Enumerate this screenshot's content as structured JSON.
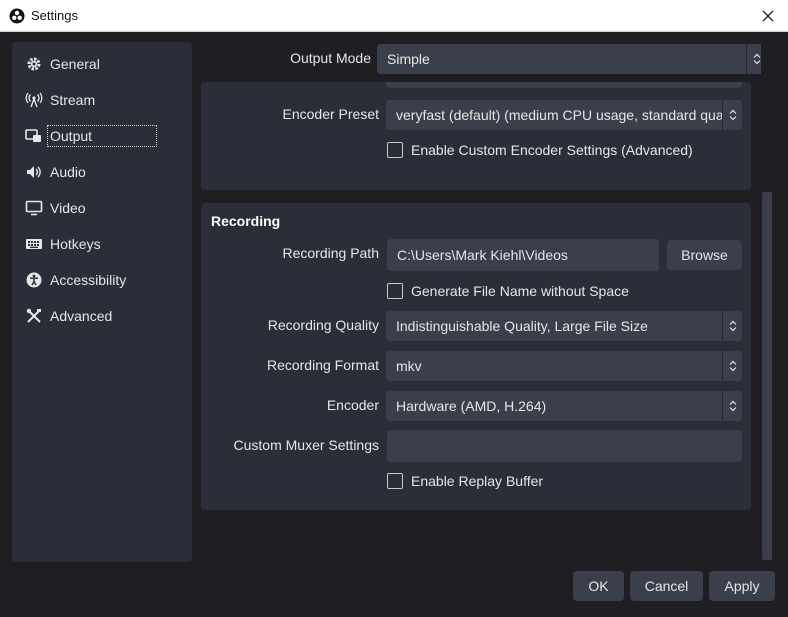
{
  "window": {
    "title": "Settings",
    "icon": "obs-logo-icon"
  },
  "sidebar": {
    "items": [
      {
        "label": "General",
        "icon": "gear-icon"
      },
      {
        "label": "Stream",
        "icon": "antenna-icon"
      },
      {
        "label": "Output",
        "icon": "output-icon",
        "selected": true
      },
      {
        "label": "Audio",
        "icon": "speaker-icon"
      },
      {
        "label": "Video",
        "icon": "monitor-icon"
      },
      {
        "label": "Hotkeys",
        "icon": "keyboard-icon"
      },
      {
        "label": "Accessibility",
        "icon": "accessibility-icon"
      },
      {
        "label": "Advanced",
        "icon": "tools-icon"
      }
    ]
  },
  "output_mode": {
    "label": "Output Mode",
    "value": "Simple"
  },
  "streaming": {
    "encoder_preset": {
      "label": "Encoder Preset",
      "value": "veryfast (default) (medium CPU usage, standard quality)"
    },
    "custom_encoder_settings": {
      "label": "Enable Custom Encoder Settings (Advanced)",
      "checked": false
    }
  },
  "recording": {
    "title": "Recording",
    "path": {
      "label": "Recording Path",
      "value": "C:\\Users\\Mark Kiehl\\Videos",
      "browse_label": "Browse"
    },
    "no_space": {
      "label": "Generate File Name without Space",
      "checked": false
    },
    "quality": {
      "label": "Recording Quality",
      "value": "Indistinguishable Quality, Large File Size"
    },
    "format": {
      "label": "Recording Format",
      "value": "mkv"
    },
    "encoder": {
      "label": "Encoder",
      "value": "Hardware (AMD, H.264)"
    },
    "muxer": {
      "label": "Custom Muxer Settings",
      "value": ""
    },
    "replay_buffer": {
      "label": "Enable Replay Buffer",
      "checked": false
    }
  },
  "footer": {
    "ok_label": "OK",
    "cancel_label": "Cancel",
    "apply_label": "Apply"
  },
  "colors": {
    "background": "#1f1f23",
    "panel": "#2b2e38",
    "control": "#3b3f4b"
  }
}
